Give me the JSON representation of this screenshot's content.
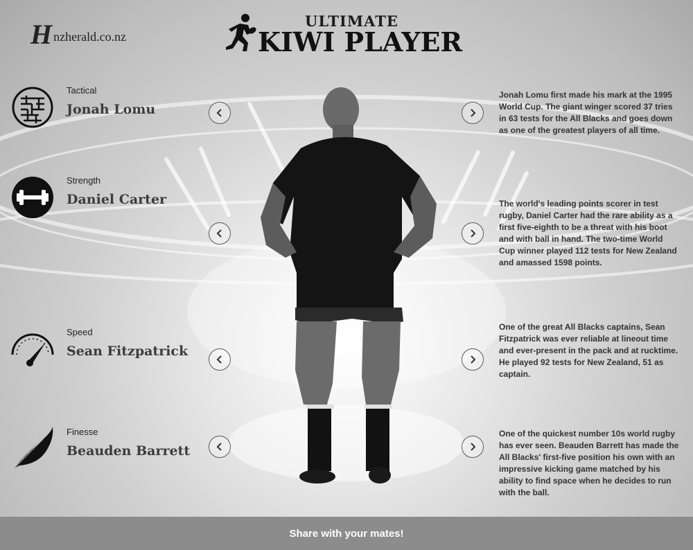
{
  "header": {
    "logo_mark": "H",
    "logo_text": "nzherald.co.nz",
    "title_top": "ULTIMATE",
    "title_main": "KIWI PLAYER"
  },
  "categories": [
    {
      "label": "Tactical",
      "icon": "maze-icon",
      "player": "Jonah Lomu",
      "description": "Jonah Lomu first made his mark at the 1995 World Cup. The giant winger scored 37 tries in 63 tests for the All Blacks and goes down as one of the greatest players of all time."
    },
    {
      "label": "Strength",
      "icon": "dumbbell-icon",
      "player": "Daniel Carter",
      "description": "The world's leading points scorer in test rugby, Daniel Carter had the rare ability as a first five-eighth to be a threat with his boot and with ball in hand. The two-time World Cup winner played 112 tests for New Zealand and amassed 1598 points."
    },
    {
      "label": "Speed",
      "icon": "speedometer-icon",
      "player": "Sean Fitzpatrick",
      "description": "One of the great All Blacks captains, Sean Fitzpatrick was ever reliable at lineout time and ever-present in the pack and at rucktime. He played 92 tests for New Zealand, 51 as captain."
    },
    {
      "label": "Finesse",
      "icon": "feather-icon",
      "player": "Beauden Barrett",
      "description": "One of the quickest number 10s world rugby has ever seen. Beauden Barrett has made the All Blacks' first-five position his own with an impressive kicking game matched by his ability to find space when he decides to run with the ball."
    }
  ],
  "footer": {
    "share_label": "Share with your mates!"
  },
  "colors": {
    "footer_bg": "#8c8c8c",
    "text_dark": "#222222"
  }
}
